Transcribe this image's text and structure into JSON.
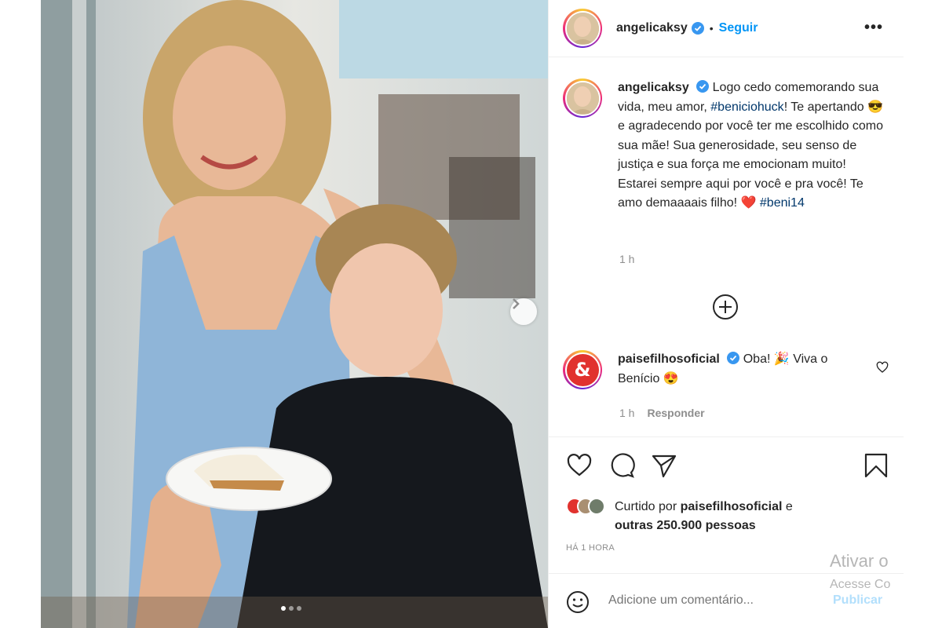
{
  "post": {
    "username": "angelicaksy",
    "separator": "•",
    "follow_label": "Seguir",
    "more_label": "•••",
    "caption_username": "angelicaksy",
    "caption_part1": "Logo cedo comemorando sua vida, meu amor, ",
    "hashtag1": "#beniciohuck",
    "caption_part2": "! Te apertando ",
    "emoji_sunglasses": "😎",
    "caption_part3": " e agradecendo por você ter me escolhido como sua mãe! Sua generosidade, seu senso de justiça e sua força me emocionam muito! Estarei sempre aqui por você e pra você! Te amo demaaaais filho! ",
    "emoji_heart": "❤️",
    "hashtag2": "#beni14",
    "caption_time": "1 h"
  },
  "comment": {
    "username": "paisefilhosoficial",
    "avatar_symbol": "&",
    "text_part1": "Oba! ",
    "emoji_party": "🎉",
    "text_part2": " Viva o Benício ",
    "emoji_hearteyes": "😍",
    "time": "1 h",
    "reply_label": "Responder"
  },
  "likes": {
    "prefix": "Curtido por ",
    "liker": "paisefilhosoficial",
    "suffix": " e",
    "others": "outras 250.900 pessoas"
  },
  "timestamp": "HÁ 1 HORA",
  "add_comment": {
    "placeholder": "Adicione um comentário...",
    "publish_label": "Publicar"
  },
  "watermark": {
    "line1": "Ativar o",
    "line2": "Acesse Co"
  },
  "colors": {
    "accent": "#0095f6",
    "hashtag": "#00376b",
    "muted": "#8e8e8e",
    "brand_red": "#e1322e"
  }
}
